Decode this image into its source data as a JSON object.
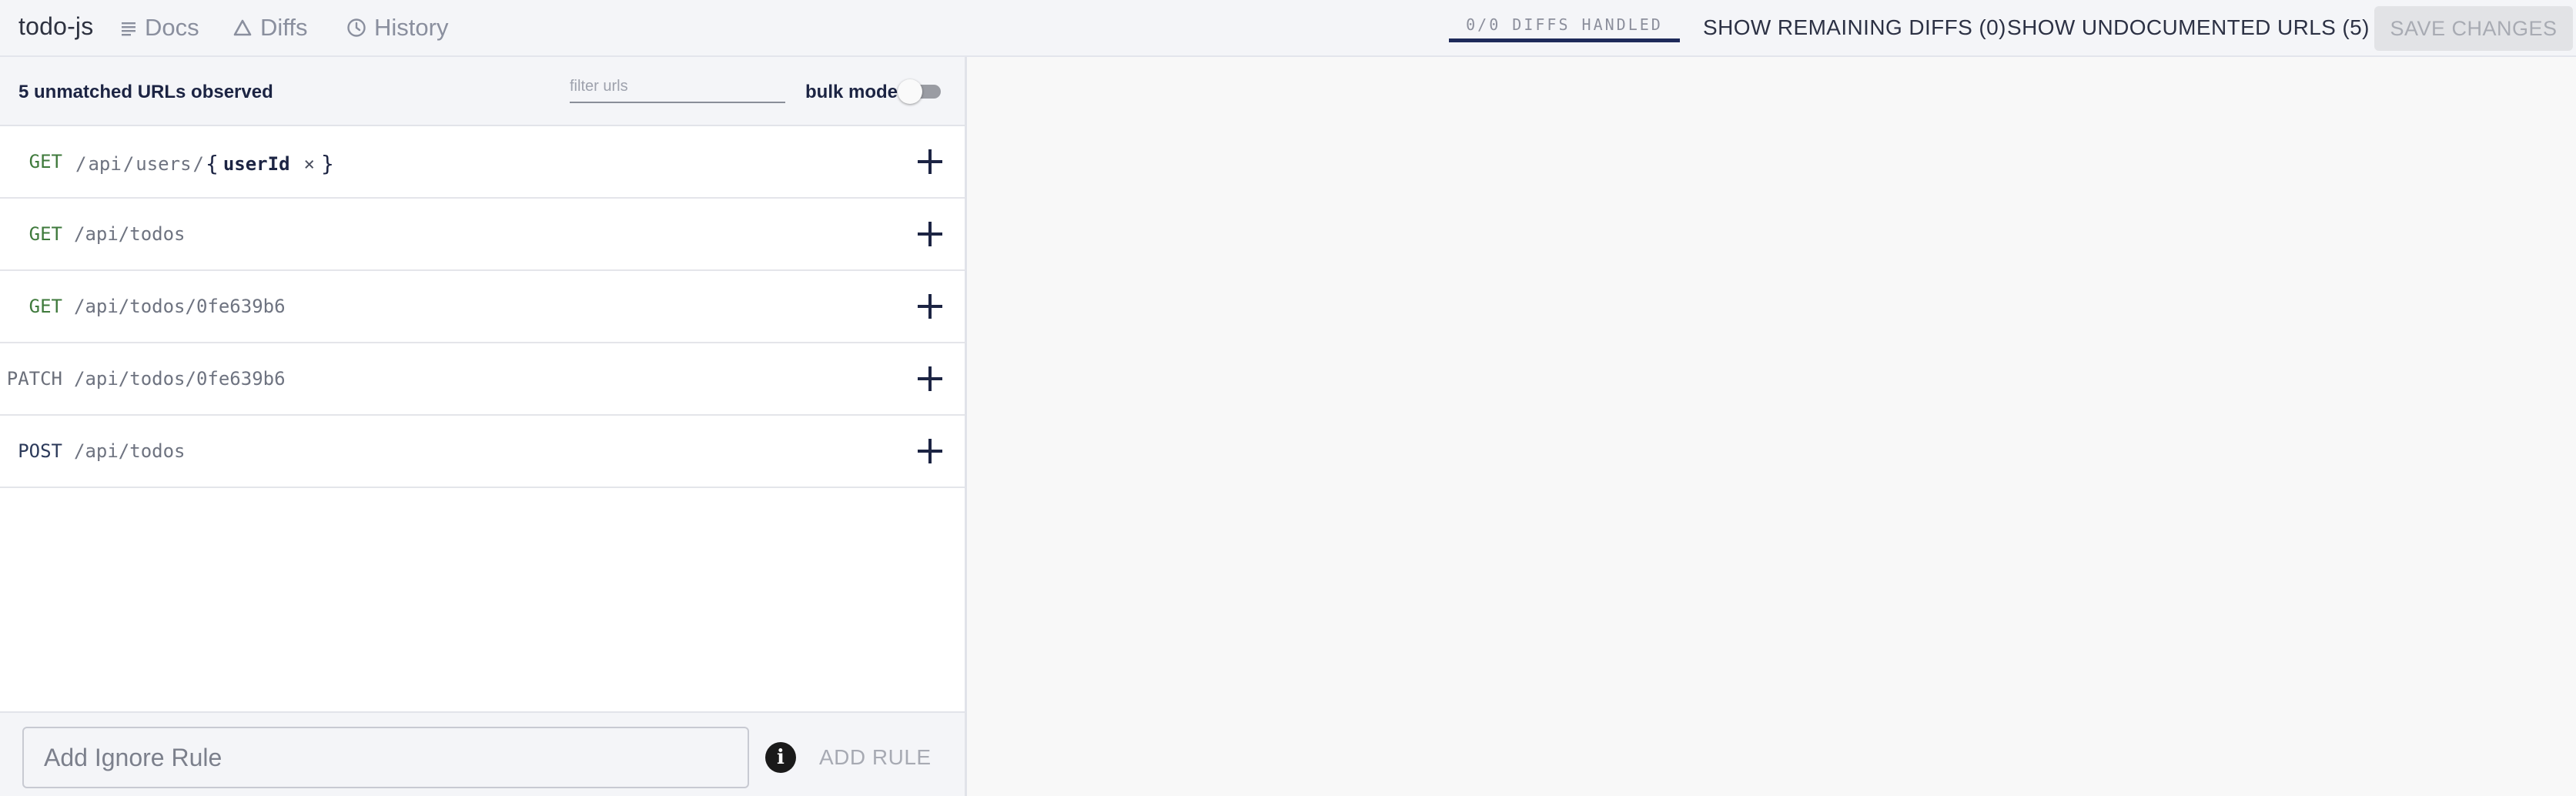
{
  "header": {
    "app_name": "todo-js",
    "nav": [
      {
        "label": "Docs",
        "icon": "docs-lines-icon"
      },
      {
        "label": "Diffs",
        "icon": "triangle-icon"
      },
      {
        "label": "History",
        "icon": "clock-icon"
      }
    ],
    "diffs_handled": "0/0 DIFFS HANDLED",
    "diffs_progress": 1.0,
    "show_remaining": "SHOW REMAINING DIFFS (0)",
    "show_undocumented": "SHOW UNDOCUMENTED URLS (5)",
    "save_changes": "SAVE CHANGES"
  },
  "panel": {
    "unmatched_label": "5 unmatched URLs observed",
    "filter_placeholder": "filter urls",
    "bulk_mode_label": "bulk mode",
    "bulk_mode_on": false
  },
  "urls": [
    {
      "method": "GET",
      "method_color": "#3f7a3c",
      "segments": [
        "api",
        "users"
      ],
      "param": "userId",
      "param_close": "×"
    },
    {
      "method": "GET",
      "method_color": "#3f7a3c",
      "path": "/api/todos"
    },
    {
      "method": "GET",
      "method_color": "#3f7a3c",
      "path": "/api/todos/0fe639b6"
    },
    {
      "method": "PATCH",
      "method_color": "#6b6f7a",
      "path": "/api/todos/0fe639b6"
    },
    {
      "method": "POST",
      "method_color": "#2c3a5a",
      "path": "/api/todos"
    }
  ],
  "footer": {
    "rule_placeholder": "Add Ignore Rule",
    "info_glyph": "i",
    "add_rule": "ADD RULE"
  },
  "colors": {
    "accent": "#1e2a5a",
    "get_method": "#3f7a3c",
    "patch_method": "#6b6f7a",
    "post_method": "#2c3a5a"
  }
}
